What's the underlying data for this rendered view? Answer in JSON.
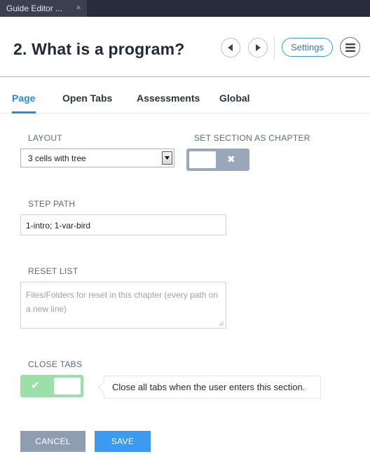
{
  "window": {
    "tab_title": "Guide Editor ...",
    "close_glyph": "×"
  },
  "header": {
    "title": "2. What is a program?",
    "settings_label": "Settings",
    "icons": [
      "prev-arrow-icon",
      "next-arrow-icon",
      "hamburger-menu-icon"
    ]
  },
  "tabs": [
    {
      "label": "Page",
      "active": true
    },
    {
      "label": "Open Tabs",
      "active": false
    },
    {
      "label": "Assessments",
      "active": false
    },
    {
      "label": "Global",
      "active": false
    }
  ],
  "form": {
    "layout": {
      "label": "LAYOUT",
      "value": "3 cells with tree"
    },
    "chapter": {
      "label": "SET SECTION AS CHAPTER",
      "enabled": false,
      "mark": "✖"
    },
    "step_path": {
      "label": "STEP PATH",
      "value": "1-intro; 1-var-bird"
    },
    "reset_list": {
      "label": "RESET LIST",
      "placeholder": "Files/Folders for reset in this chapter (every path on a new line)"
    },
    "close_tabs": {
      "label": "CLOSE TABS",
      "enabled": true,
      "mark": "✔",
      "tooltip": "Close all tabs when the user enters this section."
    }
  },
  "actions": {
    "cancel_label": "CANCEL",
    "save_label": "SAVE"
  },
  "colors": {
    "accent": "#2b8ad0",
    "tabstrip": "#262d3c",
    "toggle_off": "#9aa8ba",
    "toggle_on": "#9be0a8",
    "cancel": "#8f9db3",
    "save": "#3d9bef"
  }
}
